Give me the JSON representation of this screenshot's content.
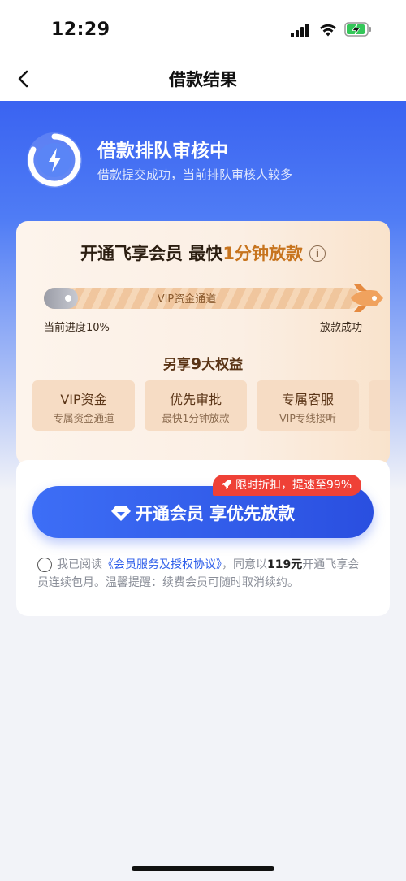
{
  "status_bar": {
    "time": "12:29"
  },
  "nav": {
    "title": "借款结果"
  },
  "hero": {
    "title": "借款排队审核中",
    "subtitle": "借款提交成功，当前排队审核人较多"
  },
  "membership": {
    "title_prefix": "开通飞享会员 最快",
    "title_highlight": "1分钟放款",
    "info_glyph": "i",
    "progress_label": "VIP资金通道",
    "progress_fraction": 0.1,
    "progress_left": "当前进度10%",
    "progress_right": "放款成功",
    "benefits_prefix": "另享",
    "benefits_count": "9",
    "benefits_suffix": "大权益",
    "benefits": [
      {
        "title": "VIP资金",
        "sub": "专属资金通道"
      },
      {
        "title": "优先审批",
        "sub": "最快1分钟放款"
      },
      {
        "title": "专属客服",
        "sub": "VIP专线接听"
      }
    ]
  },
  "action": {
    "promo": "限时折扣，提速至99%",
    "cta": "开通会员 享优先放款",
    "agree": {
      "prefix": "我已阅读",
      "link": "《会员服务及授权协议》",
      "mid": "，同意以",
      "price": "119元",
      "suffix": "开通飞享会员连续包月。温馨提醒：续费会员可随时取消续约。"
    }
  },
  "colors": {
    "accent_blue": "#3d6ef6",
    "gold": "#c7741e",
    "promo_red": "#ef4137"
  }
}
